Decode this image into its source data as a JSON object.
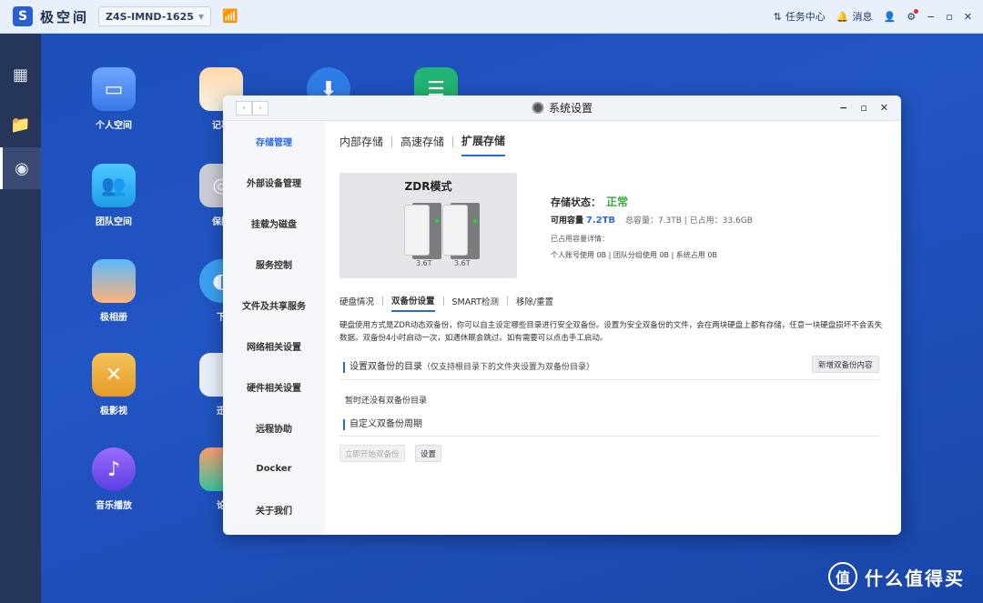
{
  "topbar": {
    "brand": "极空间",
    "device": "Z4S-IMND-1625",
    "task_center": "任务中心",
    "messages": "消息"
  },
  "desktop_icons": [
    {
      "label": "个人空间"
    },
    {
      "label": "记事"
    },
    {
      "label": "团队空间"
    },
    {
      "label": "保险"
    },
    {
      "label": "极相册"
    },
    {
      "label": "下"
    },
    {
      "label": "极影视"
    },
    {
      "label": "迅"
    },
    {
      "label": "音乐播放"
    },
    {
      "label": "论"
    }
  ],
  "window": {
    "title": "系统设置",
    "nav": [
      "存储管理",
      "外部设备管理",
      "挂载为磁盘",
      "服务控制",
      "文件及共享服务",
      "网络相关设置",
      "硬件相关设置",
      "远程协助",
      "Docker",
      "关于我们"
    ],
    "tabs": [
      "内部存储",
      "高速存储",
      "扩展存储"
    ],
    "zdr": {
      "title": "ZDR模式",
      "disk1": "3.6T",
      "disk2": "3.6T"
    },
    "status": {
      "label": "存储状态：",
      "value": "正常",
      "avail_label": "可用容量",
      "avail_value": "7.2TB",
      "total": "总容量：7.3TB | 已占用：33.6GB",
      "used_header": "已占用容量详情：",
      "used_detail": "个人账号使用 0B | 团队分组使用 0B | 系统占用 0B"
    },
    "subtabs": [
      "硬盘情况",
      "双备份设置",
      "SMART检测",
      "移除/重置"
    ],
    "description": "硬盘使用方式是ZDR动态双备份，你可以自主设定哪些目录进行安全双备份。设置为安全双备份的文件，会在两块硬盘上都有存储，任意一块硬盘损坏不会丢失数据。双备份4小时启动一次，如遇休眠会跳过。如有需要可以点击手工启动。",
    "section1_title": "设置双备份的目录",
    "section1_note": "（仅支持根目录下的文件夹设置为双备份目录）",
    "add_button": "新增双备份内容",
    "empty_text": "暂时还没有双备份目录",
    "section2_title": "自定义双备份周期",
    "start_button": "立即开始双备份",
    "set_button": "设置"
  },
  "watermark": "什么值得买"
}
